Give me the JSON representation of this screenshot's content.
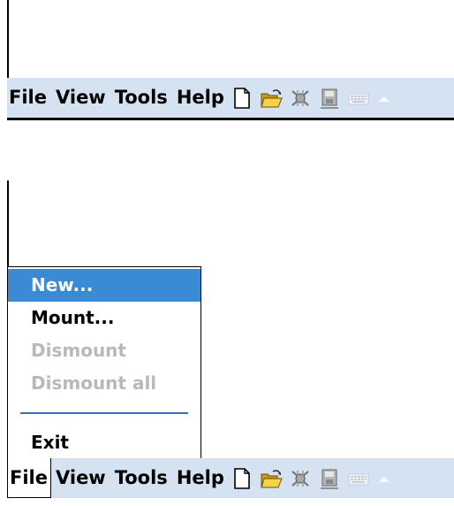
{
  "menubar": {
    "items": [
      {
        "label": "File"
      },
      {
        "label": "View"
      },
      {
        "label": "Tools"
      },
      {
        "label": "Help"
      }
    ],
    "toolbar_icons": [
      "new-document-icon",
      "open-folder-icon",
      "mount-disk-icon",
      "dismount-disk-icon",
      "keyboard-icon",
      "up-arrow-icon"
    ]
  },
  "file_menu": {
    "items": [
      {
        "label": "New...",
        "state": "selected"
      },
      {
        "label": "Mount...",
        "state": "enabled"
      },
      {
        "label": "Dismount",
        "state": "disabled"
      },
      {
        "label": "Dismount all",
        "state": "disabled"
      },
      {
        "label": "Exit",
        "state": "enabled"
      }
    ]
  },
  "colors": {
    "menubar_bg": "#d4e2f2",
    "selection": "#3a8ad4",
    "disabled_text": "#b9b9b9",
    "separator": "#3a6fb8"
  }
}
